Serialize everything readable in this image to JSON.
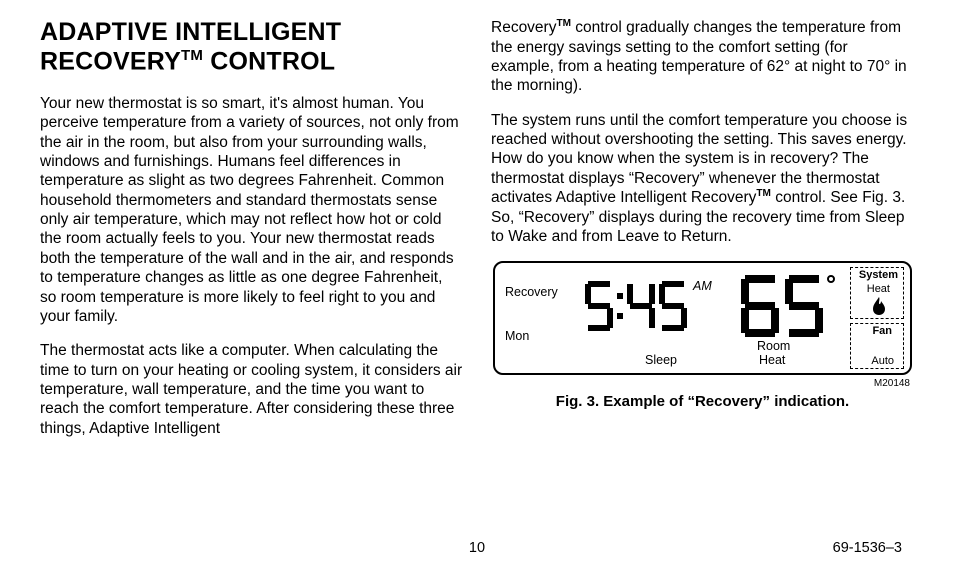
{
  "heading_part1": "ADAPTIVE INTELLIGENT",
  "heading_part2_a": "RECOVERY",
  "heading_part2_b": " CONTROL",
  "tm": "TM",
  "col1_p1": "Your new thermostat is so smart, it's almost human. You perceive temperature from a variety of sources, not only from the air in the room, but also from your surrounding walls, windows and furnishings. Humans feel differences in temperature as slight as two degrees Fahrenheit. Common household thermo­meters and standard thermostats sense only air temp­erature, which may not reflect how hot or cold the room actually feels to you. Your new thermostat reads both the temperature of the wall and in the air, and responds to temperature changes as little as one degree Fahrenheit, so room temperature is more likely to feel right to you and your family.",
  "col1_p2": "The thermostat acts like a computer. When calculat­ing the time to turn on your heating or cooling system, it considers air temperature, wall temperature, and the time you want to reach the comfort temperature. After considering these three things, Adaptive Intelligent",
  "col2_p1_a": "Recovery",
  "col2_p1_b": " control gradually changes the tempera­ture from the energy savings setting to the comfort setting (for example, from a heating temperature of 62° at night to 70° in the morning).",
  "col2_p2_a": "The system runs until the comfort temperature you choose is reached without overshooting the setting. This saves energy. How do you know when the system is in recovery? The thermostat displays “Recovery” whenever the thermostat activates Adaptive Intelligent Recovery",
  "col2_p2_b": " control. See Fig. 3. So, “Recovery” displays during the recovery time from Sleep to Wake and from Leave to Return.",
  "lcd": {
    "recovery": "Recovery",
    "mon": "Mon",
    "am": "AM",
    "sleep": "Sleep",
    "room": "Room",
    "heat_under_room": "Heat",
    "system": "System",
    "system_heat": "Heat",
    "fan": "Fan",
    "auto": "Auto",
    "time": "5:45",
    "temp": "65"
  },
  "code": "M20148",
  "caption": "Fig. 3. Example of “Recovery” indication.",
  "page_num": "10",
  "doc_num": "69-1536–3"
}
